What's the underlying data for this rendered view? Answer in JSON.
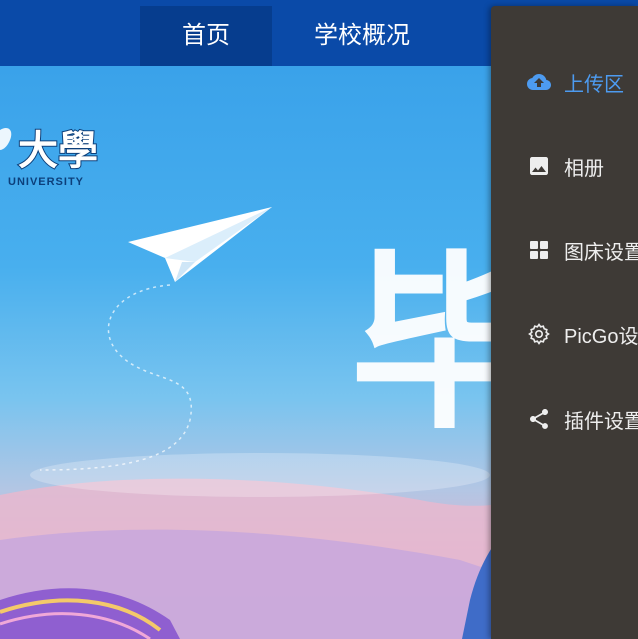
{
  "topnav": {
    "items": [
      {
        "label": "首页",
        "active": true
      },
      {
        "label": "学校概况",
        "active": false
      }
    ]
  },
  "hero": {
    "logo_chars": "大學",
    "logo_subtext": "UNIVERSITY",
    "banner_char": "毕"
  },
  "drawer": {
    "items": [
      {
        "label": "上传区",
        "icon": "cloud-upload-icon",
        "active": true
      },
      {
        "label": "相册",
        "icon": "image-icon",
        "active": false
      },
      {
        "label": "图床设置",
        "icon": "grid-icon",
        "active": false
      },
      {
        "label": "PicGo设置",
        "icon": "gear-icon",
        "active": false
      },
      {
        "label": "插件设置",
        "icon": "share-icon",
        "active": false
      }
    ]
  },
  "colors": {
    "nav_bg": "#0a4aa8",
    "drawer_bg": "#3e3a36",
    "accent": "#4d9bf0"
  }
}
